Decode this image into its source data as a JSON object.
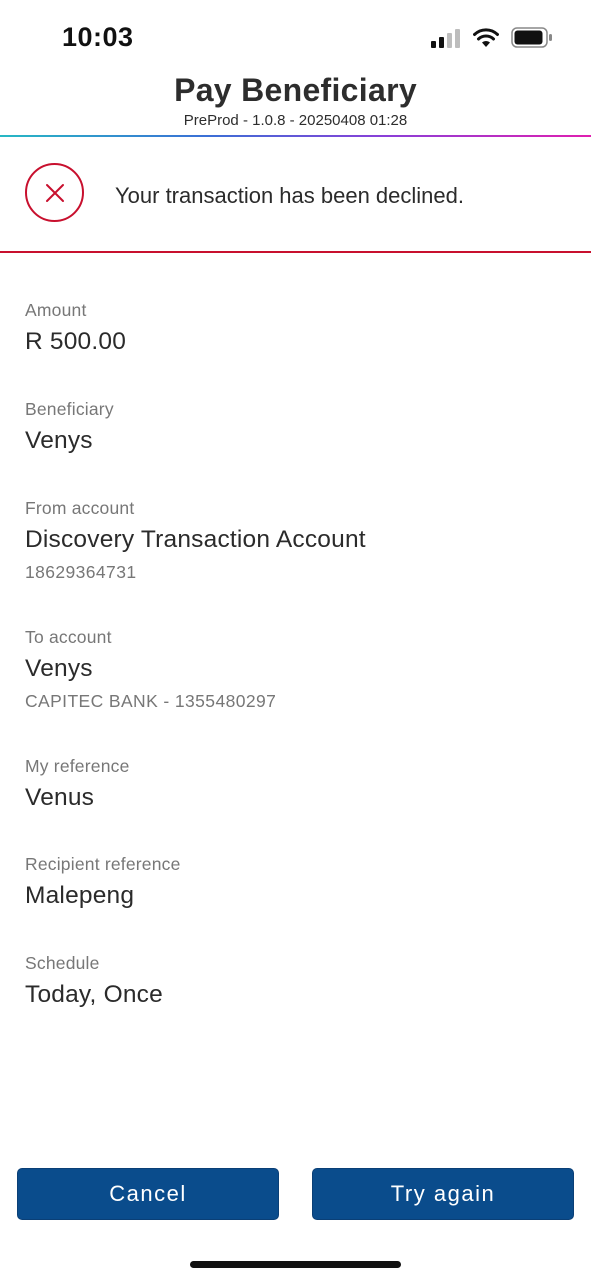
{
  "status_bar": {
    "time": "10:03",
    "icons": [
      "cellular-signal-icon",
      "wifi-icon",
      "battery-icon"
    ]
  },
  "header": {
    "title": "Pay Beneficiary",
    "subtitle": "PreProd - 1.0.8 - 20250408 01:28"
  },
  "alert": {
    "icon": "close-circle-icon",
    "message": "Your transaction has been declined.",
    "color": "#c8102e"
  },
  "details": {
    "amount": {
      "label": "Amount",
      "value": "R 500.00"
    },
    "beneficiary": {
      "label": "Beneficiary",
      "value": "Venys"
    },
    "from_account": {
      "label": "From account",
      "value": "Discovery Transaction Account",
      "sub": "18629364731"
    },
    "to_account": {
      "label": "To account",
      "value": "Venys",
      "sub": "CAPITEC BANK - 1355480297"
    },
    "my_reference": {
      "label": "My reference",
      "value": "Venus"
    },
    "recipient_reference": {
      "label": "Recipient reference",
      "value": "Malepeng"
    },
    "schedule": {
      "label": "Schedule",
      "value": "Today, Once"
    }
  },
  "actions": {
    "cancel_label": "Cancel",
    "try_again_label": "Try again",
    "button_color": "#0a4c8c"
  }
}
